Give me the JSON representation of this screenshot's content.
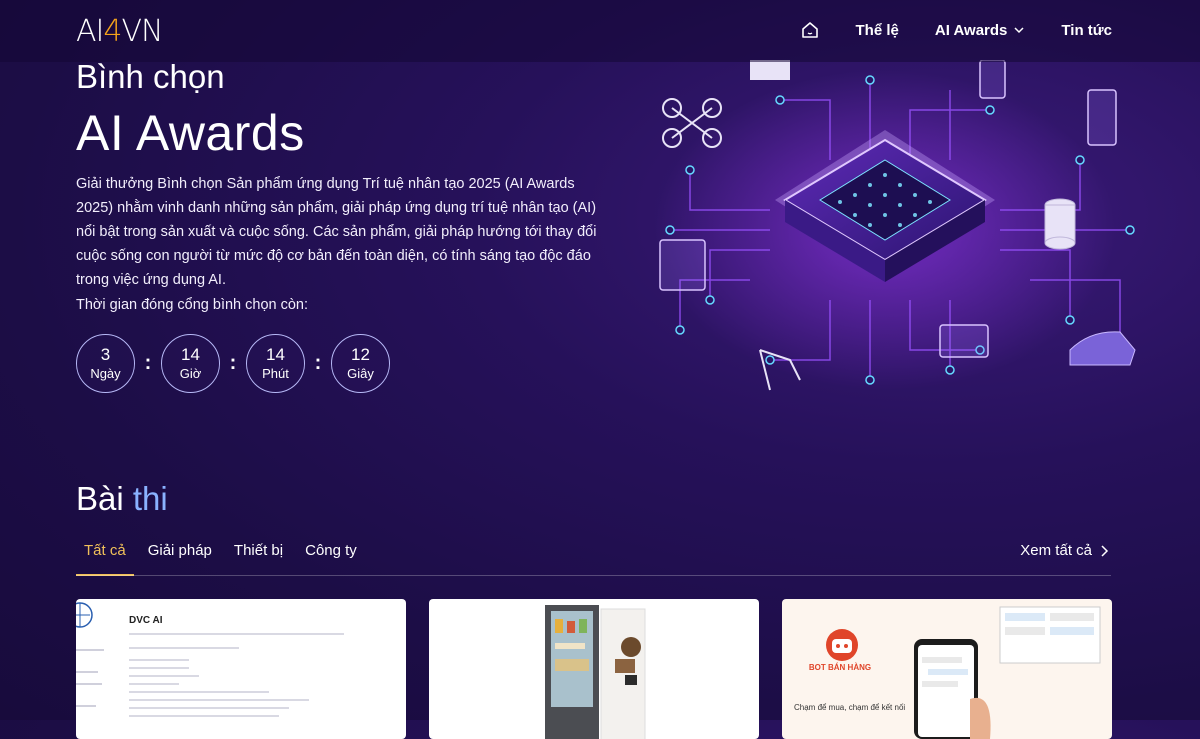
{
  "header": {
    "logo": {
      "part1": "AI",
      "part2": "4",
      "part3": "VN"
    },
    "nav": {
      "home_icon": "home-icon",
      "rules": "Thể lệ",
      "awards": "AI Awards",
      "news": "Tin tức"
    }
  },
  "hero": {
    "subtitle": "Bình chọn",
    "title": "AI Awards",
    "description": "Giải thưởng Bình chọn Sản phẩm ứng dụng Trí tuệ nhân tạo 2025 (AI Awards 2025) nhằm vinh danh những sản phẩm, giải pháp ứng dụng trí tuệ nhân tạo (AI) nổi bật trong sản xuất và cuộc sống. Các sản phẩm, giải pháp hướng tới thay đổi cuộc sống con người từ mức độ cơ bản đến toàn diện, có tính sáng tạo độc đáo trong việc ứng dụng AI.",
    "countdown_label": "Thời gian đóng cổng bình chọn còn:",
    "countdown": [
      {
        "value": "3",
        "unit": "Ngày"
      },
      {
        "value": "14",
        "unit": "Giờ"
      },
      {
        "value": "14",
        "unit": "Phút"
      },
      {
        "value": "12",
        "unit": "Giây"
      }
    ],
    "separator": ":"
  },
  "section": {
    "title_part1": "Bài",
    "title_part2": "thi",
    "tabs": [
      "Tất cả",
      "Giải pháp",
      "Thiết bị",
      "Công ty"
    ],
    "see_all": "Xem tất cả"
  },
  "cards": [
    {
      "title": "DVC AI"
    },
    {
      "title": ""
    },
    {
      "brand": "BOT BÁN HÀNG",
      "tagline": "Chạm để mua, chạm để kết nối"
    }
  ],
  "colors": {
    "background": "#1c0d46",
    "accent_gold": "#f0c05a",
    "accent_blue": "#8ab2ff",
    "logo_four": "#f3a21b"
  }
}
